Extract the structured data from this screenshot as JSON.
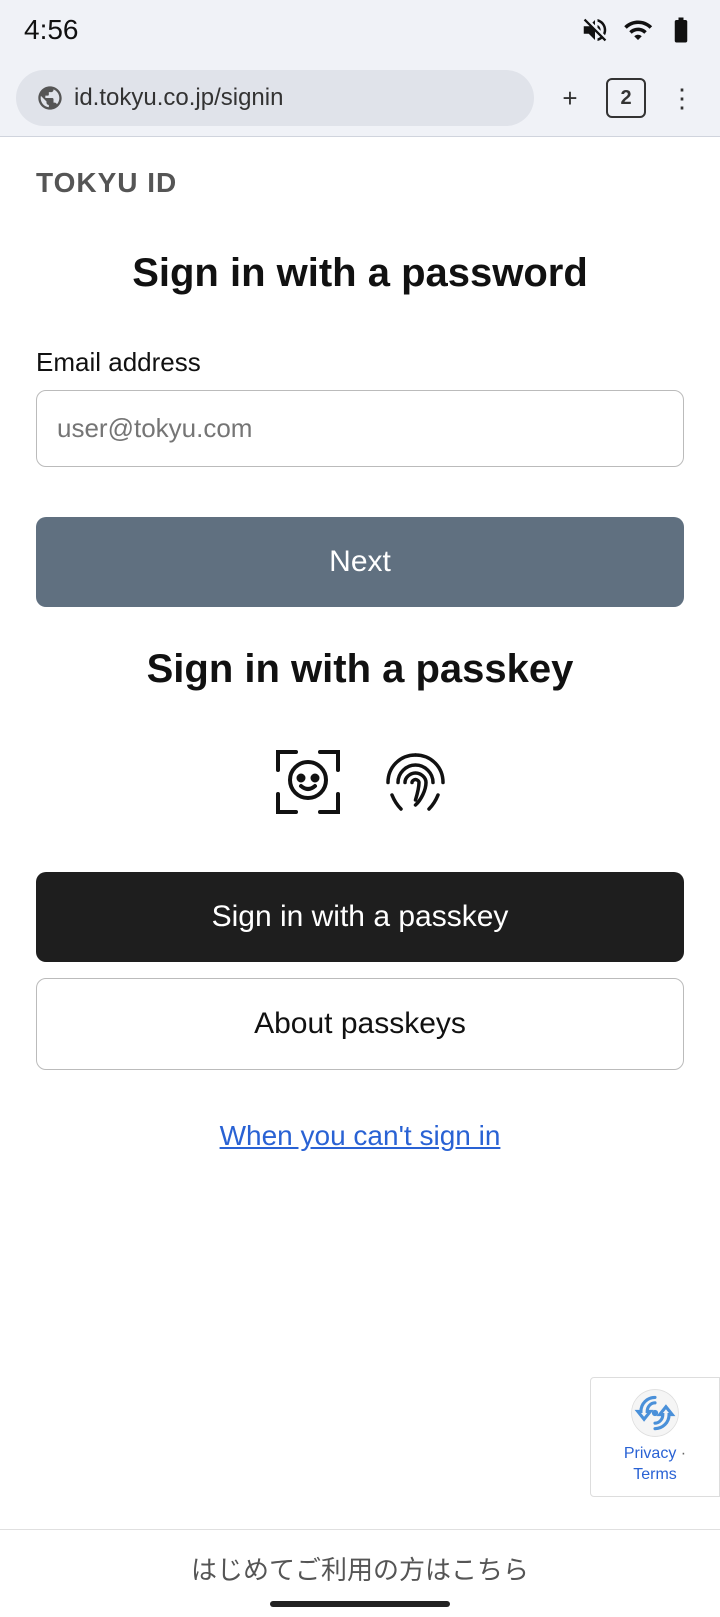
{
  "status_bar": {
    "time": "4:56",
    "icons": [
      "muted",
      "wifi",
      "battery"
    ]
  },
  "browser": {
    "address": "id.tokyu.co.jp/signin",
    "new_tab_label": "+",
    "tab_count": "2",
    "menu_label": "⋮"
  },
  "page": {
    "brand": "TOKYU ID",
    "password_section_title": "Sign in with a password",
    "email_label": "Email address",
    "email_placeholder": "user@tokyu.com",
    "next_button_label": "Next",
    "passkey_section_title": "Sign in with a passkey",
    "face_icon_label": "face-id-icon",
    "fingerprint_icon_label": "fingerprint-icon",
    "passkey_button_label": "Sign in with a passkey",
    "about_passkeys_button_label": "About passkeys",
    "cant_sign_in_label": "When you can't sign in",
    "recaptcha_privacy": "Privacy",
    "recaptcha_terms": "Terms",
    "bottom_link": "はじめてご利用の方はこちら"
  }
}
